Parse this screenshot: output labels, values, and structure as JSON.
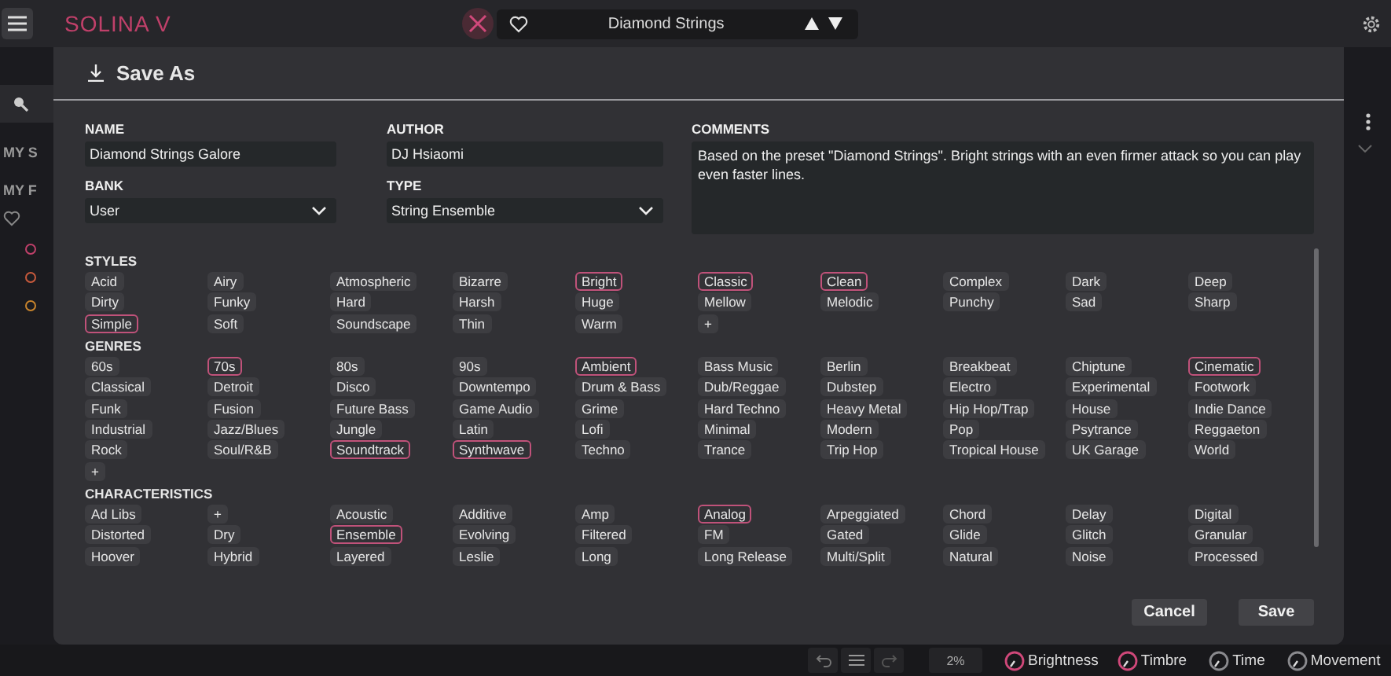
{
  "app": {
    "title": "SOLINA V",
    "preset": "Diamond Strings"
  },
  "sidebar": {
    "labels": [
      "MY S",
      "MY F"
    ],
    "dots": [
      {
        "color": "#c0406a"
      },
      {
        "color": "#c85a3c"
      },
      {
        "color": "#c8842c"
      }
    ]
  },
  "dialog": {
    "title": "Save As",
    "name": {
      "label": "NAME",
      "value": "Diamond Strings Galore"
    },
    "author": {
      "label": "AUTHOR",
      "value": "DJ Hsiaomi"
    },
    "comments": {
      "label": "COMMENTS",
      "value": "Based on the preset \"Diamond Strings\". Bright strings with an even firmer attack so you can play even faster lines."
    },
    "bank": {
      "label": "BANK",
      "value": "User"
    },
    "type": {
      "label": "TYPE",
      "value": "String Ensemble"
    },
    "sections": [
      {
        "title": "STYLES",
        "tags": [
          {
            "label": "Acid",
            "selected": false
          },
          {
            "label": "Airy",
            "selected": false
          },
          {
            "label": "Atmospheric",
            "selected": false
          },
          {
            "label": "Bizarre",
            "selected": false
          },
          {
            "label": "Bright",
            "selected": true
          },
          {
            "label": "Classic",
            "selected": true
          },
          {
            "label": "Clean",
            "selected": true
          },
          {
            "label": "Complex",
            "selected": false
          },
          {
            "label": "Dark",
            "selected": false
          },
          {
            "label": "Deep",
            "selected": false
          },
          {
            "label": "Dirty",
            "selected": false
          },
          {
            "label": "Funky",
            "selected": false
          },
          {
            "label": "Hard",
            "selected": false
          },
          {
            "label": "Harsh",
            "selected": false
          },
          {
            "label": "Huge",
            "selected": false
          },
          {
            "label": "Mellow",
            "selected": false
          },
          {
            "label": "Melodic",
            "selected": false
          },
          {
            "label": "Punchy",
            "selected": false
          },
          {
            "label": "Sad",
            "selected": false
          },
          {
            "label": "Sharp",
            "selected": false
          },
          {
            "label": "Simple",
            "selected": true
          },
          {
            "label": "Soft",
            "selected": false
          },
          {
            "label": "Soundscape",
            "selected": false
          },
          {
            "label": "Thin",
            "selected": false
          },
          {
            "label": "Warm",
            "selected": false
          },
          {
            "label": "+",
            "selected": false
          }
        ]
      },
      {
        "title": "GENRES",
        "tags": [
          {
            "label": "60s",
            "selected": false
          },
          {
            "label": "70s",
            "selected": true
          },
          {
            "label": "80s",
            "selected": false
          },
          {
            "label": "90s",
            "selected": false
          },
          {
            "label": "Ambient",
            "selected": true
          },
          {
            "label": "Bass Music",
            "selected": false
          },
          {
            "label": "Berlin",
            "selected": false
          },
          {
            "label": "Breakbeat",
            "selected": false
          },
          {
            "label": "Chiptune",
            "selected": false
          },
          {
            "label": "Cinematic",
            "selected": true
          },
          {
            "label": "Classical",
            "selected": false
          },
          {
            "label": "Detroit",
            "selected": false
          },
          {
            "label": "Disco",
            "selected": false
          },
          {
            "label": "Downtempo",
            "selected": false
          },
          {
            "label": "Drum & Bass",
            "selected": false
          },
          {
            "label": "Dub/Reggae",
            "selected": false
          },
          {
            "label": "Dubstep",
            "selected": false
          },
          {
            "label": "Electro",
            "selected": false
          },
          {
            "label": "Experimental",
            "selected": false
          },
          {
            "label": "Footwork",
            "selected": false
          },
          {
            "label": "Funk",
            "selected": false
          },
          {
            "label": "Fusion",
            "selected": false
          },
          {
            "label": "Future Bass",
            "selected": false
          },
          {
            "label": "Game Audio",
            "selected": false
          },
          {
            "label": "Grime",
            "selected": false
          },
          {
            "label": "Hard Techno",
            "selected": false
          },
          {
            "label": "Heavy Metal",
            "selected": false
          },
          {
            "label": "Hip Hop/Trap",
            "selected": false
          },
          {
            "label": "House",
            "selected": false
          },
          {
            "label": "Indie Dance",
            "selected": false
          },
          {
            "label": "Industrial",
            "selected": false
          },
          {
            "label": "Jazz/Blues",
            "selected": false
          },
          {
            "label": "Jungle",
            "selected": false
          },
          {
            "label": "Latin",
            "selected": false
          },
          {
            "label": "Lofi",
            "selected": false
          },
          {
            "label": "Minimal",
            "selected": false
          },
          {
            "label": "Modern",
            "selected": false
          },
          {
            "label": "Pop",
            "selected": false
          },
          {
            "label": "Psytrance",
            "selected": false
          },
          {
            "label": "Reggaeton",
            "selected": false
          },
          {
            "label": "Rock",
            "selected": false
          },
          {
            "label": "Soul/R&B",
            "selected": false
          },
          {
            "label": "Soundtrack",
            "selected": true
          },
          {
            "label": "Synthwave",
            "selected": true
          },
          {
            "label": "Techno",
            "selected": false
          },
          {
            "label": "Trance",
            "selected": false
          },
          {
            "label": "Trip Hop",
            "selected": false
          },
          {
            "label": "Tropical House",
            "selected": false
          },
          {
            "label": "UK Garage",
            "selected": false
          },
          {
            "label": "World",
            "selected": false
          },
          {
            "label": "+",
            "selected": false
          }
        ]
      },
      {
        "title": "CHARACTERISTICS",
        "tags": [
          {
            "label": "Ad Libs",
            "selected": false
          },
          {
            "label": "+",
            "selected": false
          },
          {
            "label": "Acoustic",
            "selected": false
          },
          {
            "label": "Additive",
            "selected": false
          },
          {
            "label": "Amp",
            "selected": false
          },
          {
            "label": "Analog",
            "selected": true
          },
          {
            "label": "Arpeggiated",
            "selected": false
          },
          {
            "label": "Chord",
            "selected": false
          },
          {
            "label": "Delay",
            "selected": false
          },
          {
            "label": "Digital",
            "selected": false
          },
          {
            "label": "Distorted",
            "selected": false
          },
          {
            "label": "Dry",
            "selected": false
          },
          {
            "label": "Ensemble",
            "selected": true
          },
          {
            "label": "Evolving",
            "selected": false
          },
          {
            "label": "Filtered",
            "selected": false
          },
          {
            "label": "FM",
            "selected": false
          },
          {
            "label": "Gated",
            "selected": false
          },
          {
            "label": "Glide",
            "selected": false
          },
          {
            "label": "Glitch",
            "selected": false
          },
          {
            "label": "Granular",
            "selected": false
          },
          {
            "label": "Hoover",
            "selected": false
          },
          {
            "label": "Hybrid",
            "selected": false
          },
          {
            "label": "Layered",
            "selected": false
          },
          {
            "label": "Leslie",
            "selected": false
          },
          {
            "label": "Long",
            "selected": false
          },
          {
            "label": "Long Release",
            "selected": false
          },
          {
            "label": "Multi/Split",
            "selected": false
          },
          {
            "label": "Natural",
            "selected": false
          },
          {
            "label": "Noise",
            "selected": false
          },
          {
            "label": "Processed",
            "selected": false
          }
        ]
      }
    ],
    "buttons": [
      "Cancel",
      "Save"
    ]
  },
  "bottom_bar": {
    "zoom": "2%",
    "knobs": [
      {
        "label": "Brightness",
        "color": "#d0487a"
      },
      {
        "label": "Timbre",
        "color": "#d0487a"
      },
      {
        "label": "Time",
        "color": "#8a8a8e"
      },
      {
        "label": "Movement",
        "color": "#8a8a8e"
      }
    ]
  }
}
